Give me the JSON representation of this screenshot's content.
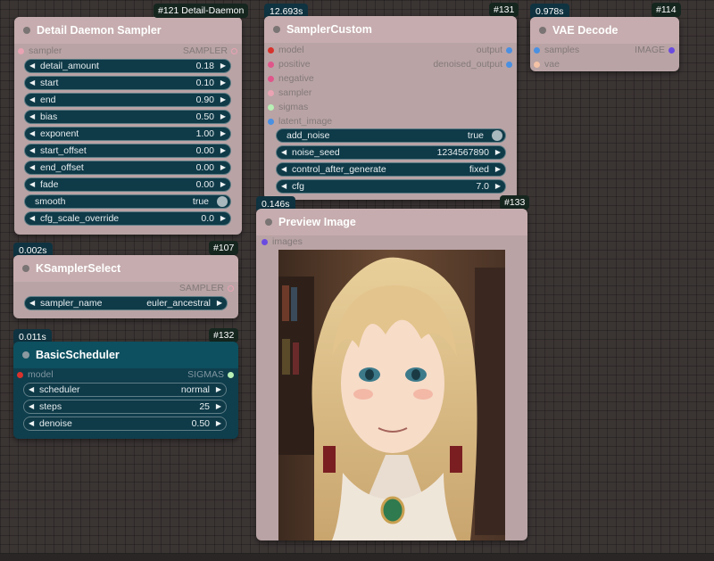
{
  "nodes": {
    "detail_daemon": {
      "title": "Detail Daemon Sampler",
      "badge": "#121 Detail-Daemon",
      "input": "sampler",
      "output": "SAMPLER",
      "widgets": [
        {
          "label": "detail_amount",
          "value": "0.18"
        },
        {
          "label": "start",
          "value": "0.10"
        },
        {
          "label": "end",
          "value": "0.90"
        },
        {
          "label": "bias",
          "value": "0.50"
        },
        {
          "label": "exponent",
          "value": "1.00"
        },
        {
          "label": "start_offset",
          "value": "0.00"
        },
        {
          "label": "end_offset",
          "value": "0.00"
        },
        {
          "label": "fade",
          "value": "0.00"
        },
        {
          "label": "smooth",
          "value": "true"
        },
        {
          "label": "cfg_scale_override",
          "value": "0.0"
        }
      ]
    },
    "sampler_custom": {
      "title": "SamplerCustom",
      "timing": "12.693s",
      "badge": "#131",
      "inputs": [
        "model",
        "positive",
        "negative",
        "sampler",
        "sigmas",
        "latent_image"
      ],
      "outputs": [
        "output",
        "denoised_output"
      ],
      "widgets": [
        {
          "label": "add_noise",
          "value": "true"
        },
        {
          "label": "noise_seed",
          "value": "1234567890"
        },
        {
          "label": "control_after_generate",
          "value": "fixed"
        },
        {
          "label": "cfg",
          "value": "7.0"
        }
      ]
    },
    "vae_decode": {
      "title": "VAE Decode",
      "timing": "0.978s",
      "badge": "#114",
      "inputs": [
        "samples",
        "vae"
      ],
      "output": "IMAGE"
    },
    "ksampler_select": {
      "title": "KSamplerSelect",
      "timing": "0.002s",
      "badge": "#107",
      "output": "SAMPLER",
      "widgets": [
        {
          "label": "sampler_name",
          "value": "euler_ancestral"
        }
      ]
    },
    "basic_scheduler": {
      "title": "BasicScheduler",
      "timing": "0.011s",
      "badge": "#132",
      "input": "model",
      "output": "SIGMAS",
      "widgets": [
        {
          "label": "scheduler",
          "value": "normal"
        },
        {
          "label": "steps",
          "value": "25"
        },
        {
          "label": "denoise",
          "value": "0.50"
        }
      ]
    },
    "preview_image": {
      "title": "Preview Image",
      "timing": "0.146s",
      "badge": "#133",
      "input": "images"
    }
  },
  "colors": {
    "canvas": "#3a3433",
    "node_pink": "#b9a3a5",
    "node_teal": "#0f3e4d",
    "widget_bg": "#0f3a48",
    "slot_model": "#d8322c",
    "slot_conditioning": "#e0568a",
    "slot_sampler": "#e9a3b2",
    "slot_sigmas": "#b8f0b5",
    "slot_latent": "#4a90e2",
    "slot_image": "#6a4be0",
    "slot_vae": "#f4c2a5"
  },
  "icons": [
    "arrow-left-icon",
    "arrow-right-icon",
    "toggle-knob-icon",
    "title-dot-icon"
  ]
}
